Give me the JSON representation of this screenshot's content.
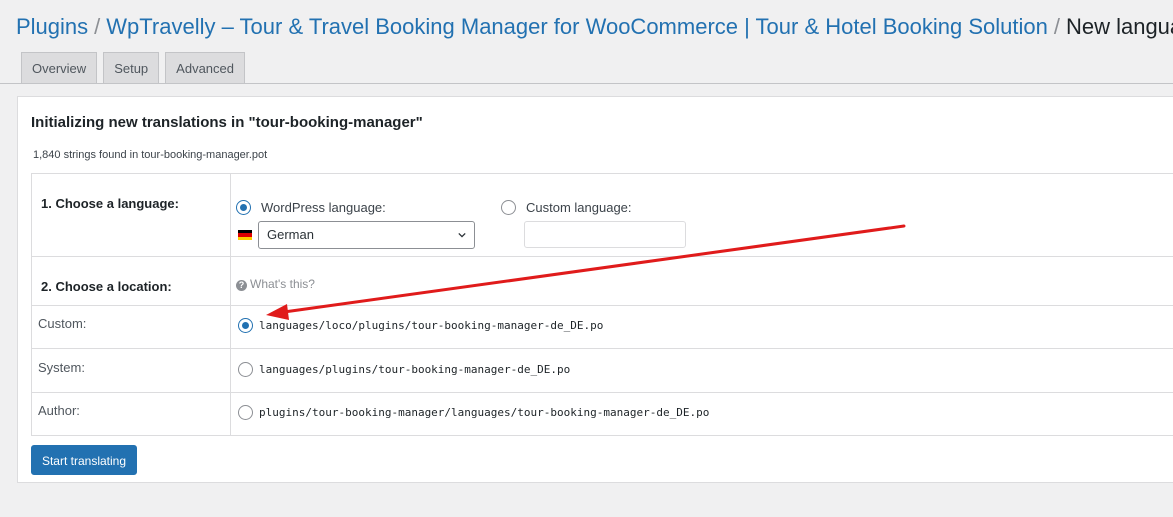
{
  "breadcrumb": {
    "root": "Plugins",
    "plugin": "WpTravelly – Tour & Travel Booking Manager for WooCommerce | Tour & Hotel Booking Solution",
    "current": "New language",
    "separator": "/"
  },
  "tabs": [
    {
      "label": "Overview"
    },
    {
      "label": "Setup"
    },
    {
      "label": "Advanced"
    }
  ],
  "panel": {
    "title": "Initializing new translations in \"tour-booking-manager\"",
    "subtitle": "1,840 strings found in tour-booking-manager.pot"
  },
  "language": {
    "label": "1. Choose a language:",
    "wordpress_option": "WordPress language:",
    "custom_option": "Custom language:",
    "selected": "wordpress",
    "select_value": "German",
    "flag_icon": "germany-flag-icon",
    "custom_value": ""
  },
  "location": {
    "label": "2. Choose a location:",
    "help": "What's this?",
    "selected": "custom",
    "options": [
      {
        "label": "Custom:",
        "path": "languages/loco/plugins/tour-booking-manager-de_DE.po"
      },
      {
        "label": "System:",
        "path": "languages/plugins/tour-booking-manager-de_DE.po"
      },
      {
        "label": "Author:",
        "path": "plugins/tour-booking-manager/languages/tour-booking-manager-de_DE.po"
      }
    ]
  },
  "actions": {
    "start": "Start translating"
  },
  "colors": {
    "link": "#2271b1",
    "button": "#2271b1",
    "annotation_arrow": "#e01b1b"
  }
}
